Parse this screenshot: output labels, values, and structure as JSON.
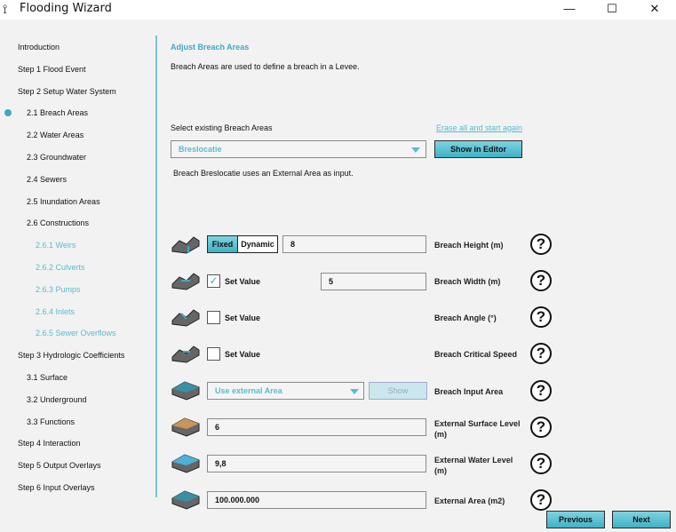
{
  "window": {
    "title": "Flooding Wizard",
    "minimize": "—",
    "maximize": "☐",
    "close": "✕"
  },
  "sidebar": {
    "items": [
      {
        "label": "Introduction",
        "level": 0
      },
      {
        "label": "Step 1 Flood Event",
        "level": 0
      },
      {
        "label": "Step 2 Setup Water System",
        "level": 0
      },
      {
        "label": "2.1 Breach Areas",
        "level": 1,
        "active": true
      },
      {
        "label": "2.2 Water Areas",
        "level": 1
      },
      {
        "label": "2.3 Groundwater",
        "level": 1
      },
      {
        "label": "2.4 Sewers",
        "level": 1
      },
      {
        "label": "2.5 Inundation Areas",
        "level": 1
      },
      {
        "label": "2.6 Constructions",
        "level": 1
      },
      {
        "label": "2.6.1 Weirs",
        "level": 2
      },
      {
        "label": "2.6.2 Culverts",
        "level": 2
      },
      {
        "label": "2.6.3 Pumps",
        "level": 2
      },
      {
        "label": "2.6.4 Inlets",
        "level": 2
      },
      {
        "label": "2.6.5 Sewer Overflows",
        "level": 2
      },
      {
        "label": "Step 3 Hydrologic Coefficients",
        "level": 0
      },
      {
        "label": "3.1 Surface",
        "level": 1
      },
      {
        "label": "3.2 Underground",
        "level": 1
      },
      {
        "label": "3.3 Functions",
        "level": 1
      },
      {
        "label": "Step 4 Interaction",
        "level": 0
      },
      {
        "label": "Step 5 Output Overlays",
        "level": 0
      },
      {
        "label": "Step 6 Input Overlays",
        "level": 0
      }
    ]
  },
  "main": {
    "heading": "Adjust Breach Areas",
    "description": "Breach Areas are used to define a breach in a Levee.",
    "select_label": "Select existing Breach Areas",
    "erase_link": "Erase all and start again",
    "selected_breach": "Breslocatie",
    "show_in_editor": "Show in Editor",
    "info": "Breach Breslocatie uses an External Area as input.",
    "height": {
      "fixed": "Fixed",
      "dynamic": "Dynamic",
      "value": "8",
      "label": "Breach Height (m)",
      "mode": "Fixed"
    },
    "width": {
      "set_value": "Set Value",
      "checked": true,
      "value": "5",
      "label": "Breach Width (m)"
    },
    "angle": {
      "set_value": "Set Value",
      "checked": false,
      "label": "Breach Angle (°)"
    },
    "speed": {
      "set_value": "Set Value",
      "checked": false,
      "label": "Breach Critical Speed"
    },
    "input_area": {
      "selected": "Use external Area",
      "show": "Show",
      "label": "Breach Input Area"
    },
    "surface": {
      "value": "6",
      "label": "External Surface Level (m)"
    },
    "water": {
      "value": "9,8",
      "label": "External Water Level (m)"
    },
    "area": {
      "value": "100.000.000",
      "label": "External Area (m2)"
    },
    "help": "?",
    "previous": "Previous",
    "next": "Next"
  },
  "colors": {
    "accent": "#3eb2c6",
    "link": "#5bbccc"
  }
}
